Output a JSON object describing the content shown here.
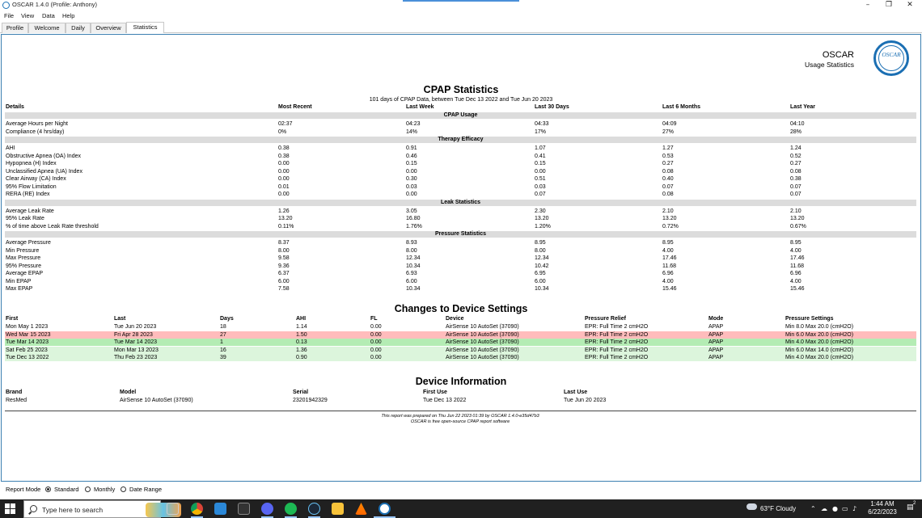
{
  "window": {
    "title": "OSCAR 1.4.0 (Profile: Anthony)",
    "minimize": "–",
    "maximize": "❐",
    "close": "✕"
  },
  "menu": [
    "File",
    "View",
    "Data",
    "Help"
  ],
  "tabs": [
    "Profile",
    "Welcome",
    "Daily",
    "Overview",
    "Statistics"
  ],
  "active_tab": "Statistics",
  "logo": {
    "name": "OSCAR",
    "subtitle": "Usage Statistics",
    "badge": "OSCAR"
  },
  "cpap": {
    "title": "CPAP Statistics",
    "subtitle": "101 days of CPAP Data, between Tue Dec 13 2022 and Tue Jun 20 2023",
    "columns": [
      "Details",
      "Most Recent",
      "Last Week",
      "Last 30 Days",
      "Last 6 Months",
      "Last Year"
    ],
    "sections": [
      {
        "name": "CPAP Usage",
        "rows": [
          [
            "Average Hours per Night",
            "02:37",
            "04:23",
            "04:33",
            "04:09",
            "04:10"
          ],
          [
            "Compliance (4 hrs/day)",
            "0%",
            "14%",
            "17%",
            "27%",
            "28%"
          ]
        ]
      },
      {
        "name": "Therapy Efficacy",
        "rows": [
          [
            "AHI",
            "0.38",
            "0.91",
            "1.07",
            "1.27",
            "1.24"
          ],
          [
            "Obstructive Apnea (OA) Index",
            "0.38",
            "0.46",
            "0.41",
            "0.53",
            "0.52"
          ],
          [
            "Hypopnea (H) Index",
            "0.00",
            "0.15",
            "0.15",
            "0.27",
            "0.27"
          ],
          [
            "Unclassified Apnea (UA) Index",
            "0.00",
            "0.00",
            "0.00",
            "0.08",
            "0.08"
          ],
          [
            "Clear Airway (CA) Index",
            "0.00",
            "0.30",
            "0.51",
            "0.40",
            "0.38"
          ],
          [
            "95% Flow Limitation",
            "0.01",
            "0.03",
            "0.03",
            "0.07",
            "0.07"
          ],
          [
            "RERA (RE) Index",
            "0.00",
            "0.00",
            "0.07",
            "0.08",
            "0.07"
          ]
        ]
      },
      {
        "name": "Leak Statistics",
        "rows": [
          [
            "Average Leak Rate",
            "1.26",
            "3.05",
            "2.30",
            "2.10",
            "2.10"
          ],
          [
            "95% Leak Rate",
            "13.20",
            "16.80",
            "13.20",
            "13.20",
            "13.20"
          ],
          [
            "% of time above Leak Rate threshold",
            "0.11%",
            "1.76%",
            "1.20%",
            "0.72%",
            "0.67%"
          ]
        ]
      },
      {
        "name": "Pressure Statistics",
        "rows": [
          [
            "Average Pressure",
            "8.37",
            "8.93",
            "8.95",
            "8.95",
            "8.95"
          ],
          [
            "Min Pressure",
            "8.00",
            "8.00",
            "8.00",
            "4.00",
            "4.00"
          ],
          [
            "Max Pressure",
            "9.58",
            "12.34",
            "12.34",
            "17.46",
            "17.46"
          ],
          [
            "95% Pressure",
            "9.36",
            "10.34",
            "10.42",
            "11.68",
            "11.68"
          ],
          [
            "Average EPAP",
            "6.37",
            "6.93",
            "6.95",
            "6.96",
            "6.96"
          ],
          [
            "Min EPAP",
            "6.00",
            "6.00",
            "6.00",
            "4.00",
            "4.00"
          ],
          [
            "Max EPAP",
            "7.58",
            "10.34",
            "10.34",
            "15.46",
            "15.46"
          ]
        ]
      }
    ]
  },
  "changes": {
    "title": "Changes to Device Settings",
    "columns": [
      "First",
      "Last",
      "Days",
      "AHI",
      "FL",
      "Device",
      "Pressure Relief",
      "Mode",
      "Pressure Settings"
    ],
    "rows": [
      {
        "cells": [
          "Mon May 1 2023",
          "Tue Jun 20 2023",
          "18",
          "1.14",
          "0.00",
          "AirSense 10 AutoSet (37090)",
          "EPR: Full Time 2 cmH2O",
          "APAP",
          "Min 8.0 Max 20.0 (cmH2O)"
        ],
        "color": "#ffffff"
      },
      {
        "cells": [
          "Wed Mar 15 2023",
          "Fri Apr 28 2023",
          "27",
          "1.50",
          "0.00",
          "AirSense 10 AutoSet (37090)",
          "EPR: Full Time 2 cmH2O",
          "APAP",
          "Min 6.0 Max 20.0 (cmH2O)"
        ],
        "color": "#ffbcbc"
      },
      {
        "cells": [
          "Tue Mar 14 2023",
          "Tue Mar 14 2023",
          "1",
          "0.13",
          "0.00",
          "AirSense 10 AutoSet (37090)",
          "EPR: Full Time 2 cmH2O",
          "APAP",
          "Min 4.0 Max 20.0 (cmH2O)"
        ],
        "color": "#b4ecb4"
      },
      {
        "cells": [
          "Sat Feb 25 2023",
          "Mon Mar 13 2023",
          "16",
          "1.36",
          "0.00",
          "AirSense 10 AutoSet (37090)",
          "EPR: Full Time 2 cmH2O",
          "APAP",
          "Min 6.0 Max 14.0 (cmH2O)"
        ],
        "color": "#dcf5dc"
      },
      {
        "cells": [
          "Tue Dec 13 2022",
          "Thu Feb 23 2023",
          "39",
          "0.90",
          "0.00",
          "AirSense 10 AutoSet (37090)",
          "EPR: Full Time 2 cmH2O",
          "APAP",
          "Min 4.0 Max 20.0 (cmH2O)"
        ],
        "color": "#dcf5dc"
      }
    ]
  },
  "device": {
    "title": "Device Information",
    "columns": [
      "Brand",
      "Model",
      "Serial",
      "First Use",
      "Last Use"
    ],
    "row": [
      "ResMed",
      "AirSense 10 AutoSet (37090)",
      "23201942329",
      "Tue Dec 13 2022",
      "Tue Jun 20 2023"
    ]
  },
  "footer": {
    "line1": "This report was prepared on Thu Jun 22 2023 01:39 by OSCAR 1.4.0-e35d47b3",
    "line2": "OSCAR is free open-source CPAP report software"
  },
  "report_mode": {
    "label": "Report Mode",
    "options": [
      "Standard",
      "Monthly",
      "Date Range"
    ],
    "selected": "Standard"
  },
  "taskbar": {
    "search_placeholder": "Type here to search",
    "weather": "63°F  Cloudy",
    "time": "1:44 AM",
    "date": "6/22/2023",
    "notification_count": "2",
    "apps": [
      "task-view",
      "chrome",
      "windows-app",
      "terminal",
      "discord",
      "spotify",
      "steam",
      "file-explorer",
      "vlc",
      "oscar"
    ]
  },
  "colors": {
    "accent": "#1b6fb3",
    "section_bar": "#dcdcdc",
    "taskbar": "#202020"
  }
}
